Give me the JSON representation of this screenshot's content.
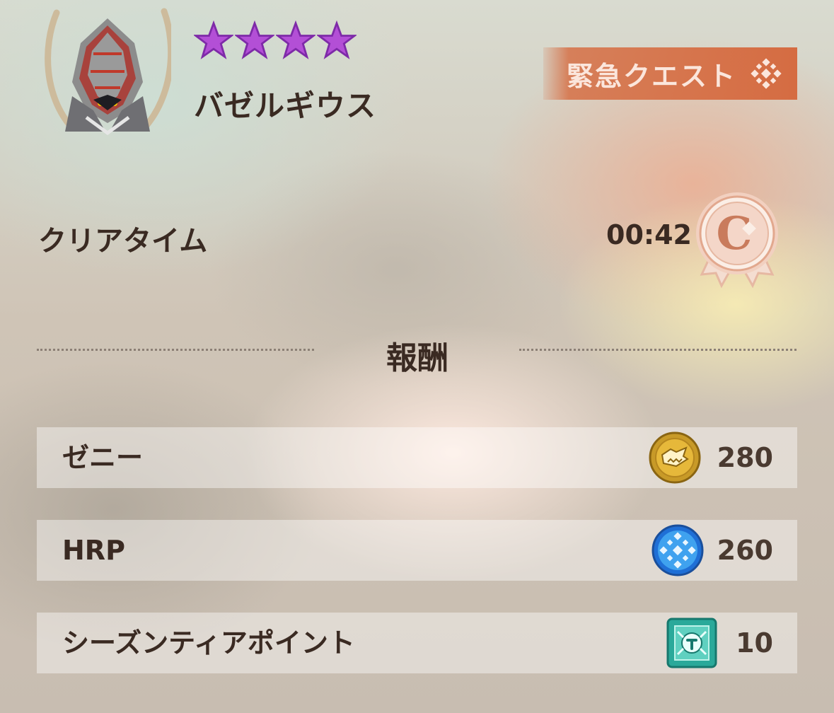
{
  "quest": {
    "monster_icon": "monster-portrait-icon",
    "monster_name": "バゼルギウス",
    "star_rating": 4,
    "star_color": "#b34fd6",
    "badge_label": "緊急クエスト",
    "badge_icon": "hrp-emblem-icon",
    "badge_color": "#d56c42"
  },
  "clear_time": {
    "label": "クリアタイム",
    "value": "00:42",
    "rank": "C",
    "rank_icon": "rank-medal-icon"
  },
  "rewards": {
    "heading": "報酬",
    "items": [
      {
        "label": "ゼニー",
        "value": "280",
        "icon": "zenny-coin-icon"
      },
      {
        "label": "HRP",
        "value": "260",
        "icon": "hrp-orb-icon"
      },
      {
        "label": "シーズンティアポイント",
        "value": "10",
        "icon": "season-tier-point-icon"
      }
    ]
  }
}
